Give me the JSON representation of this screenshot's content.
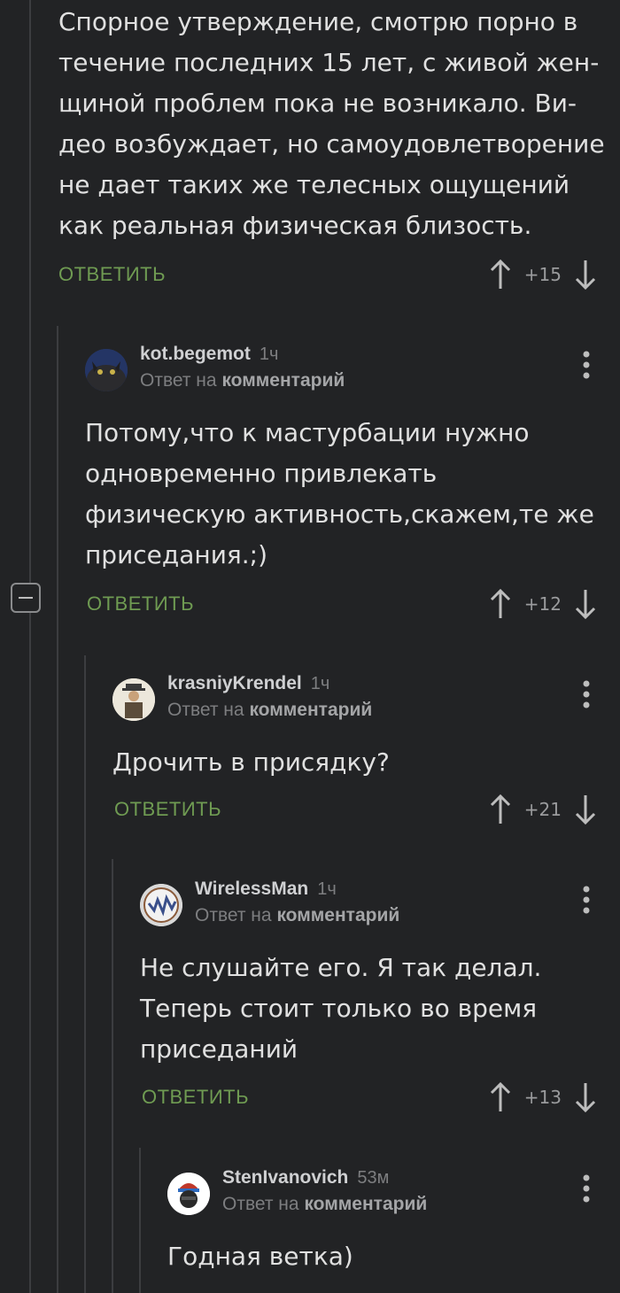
{
  "top_comment": {
    "text": "Спорное утверждение, смотрю порно в\nтечение последних 15 лет, с живой жен-\nщиной проблем пока не возникало. Ви-\nдео возбуждает, но самоудовлетворение\nне дает таких же телесных ощущений\nкак реальная физическая близость.",
    "reply_label": "ОТВЕТИТЬ",
    "score": "+15"
  },
  "comments": [
    {
      "username": "kot.begemot",
      "time": "1ч",
      "reply_prefix": "Ответ на",
      "reply_target": "комментарий",
      "text": "Потому,что к мастурбации нужно\nодновременно привлекать\nфизическую активность,скажем,те же\nприседания.;)",
      "reply_label": "ОТВЕТИТЬ",
      "score": "+12"
    },
    {
      "username": "krasniyKrendel",
      "time": "1ч",
      "reply_prefix": "Ответ на",
      "reply_target": "комментарий",
      "text": "Дрочить в присядку?",
      "reply_label": "ОТВЕТИТЬ",
      "score": "+21"
    },
    {
      "username": "WirelessMan",
      "time": "1ч",
      "reply_prefix": "Ответ на",
      "reply_target": "комментарий",
      "text": "Не слушайте его. Я так делал.\nТеперь стоит только во время\nприседаний",
      "reply_label": "ОТВЕТИТЬ",
      "score": "+13"
    },
    {
      "username": "StenIvanovich",
      "time": "53м",
      "reply_prefix": "Ответ на",
      "reply_target": "комментарий",
      "text": "Годная ветка)"
    }
  ],
  "colors": {
    "background": "#222325",
    "reply_green": "#6f9b52",
    "thread_line": "#3c3d40"
  },
  "icons": [
    "upvote-arrow-icon",
    "downvote-arrow-icon",
    "more-vertical-icon",
    "collapse-minus-icon"
  ]
}
